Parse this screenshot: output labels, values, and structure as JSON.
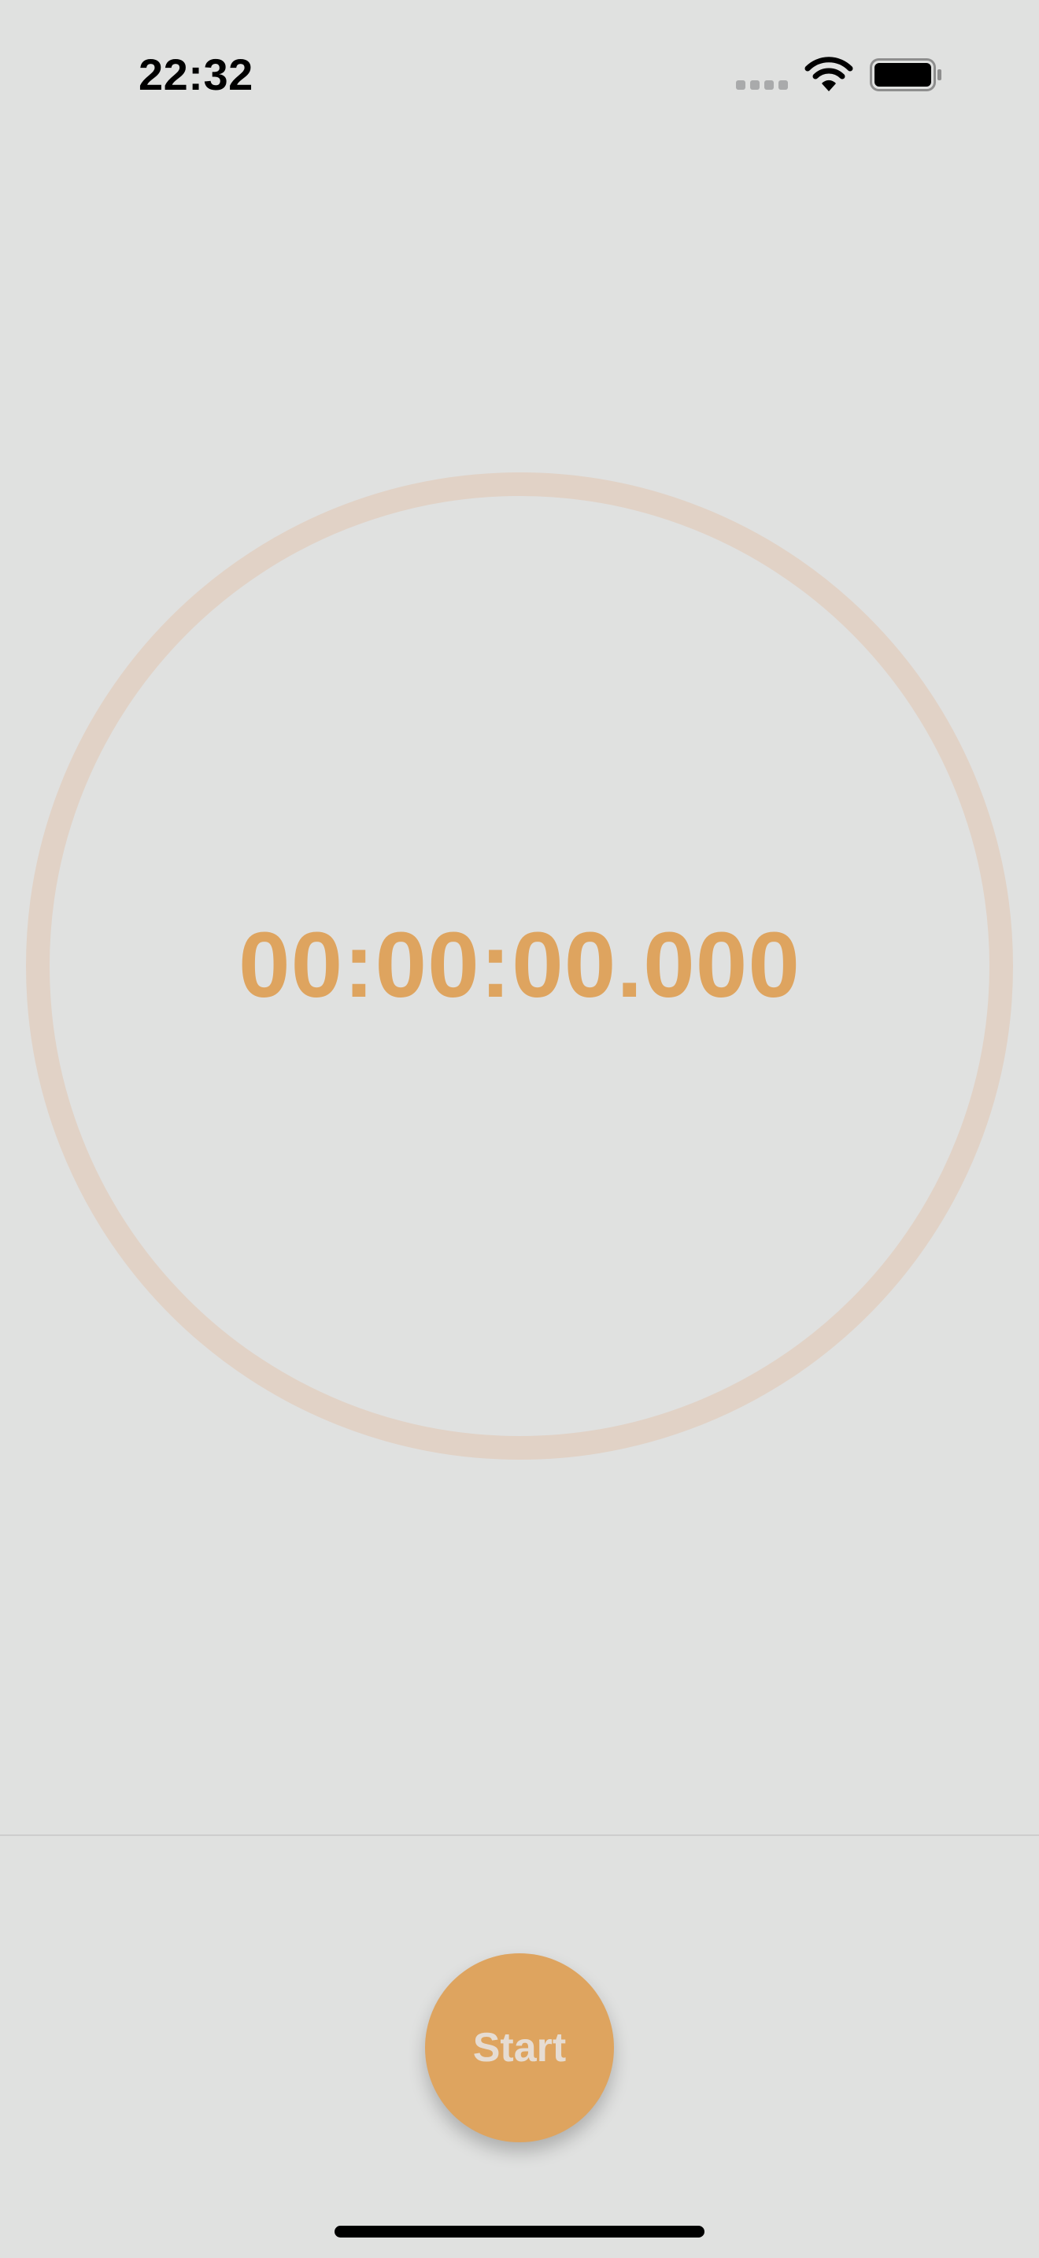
{
  "status_bar": {
    "time": "22:32",
    "icons": [
      "cellular-signal-icon",
      "wifi-icon",
      "battery-icon"
    ]
  },
  "timer": {
    "display": "00:00:00.000",
    "ring_progress": 0
  },
  "controls": {
    "start_label": "Start"
  },
  "colors": {
    "background": "#e0e1e0",
    "accent": "#dea45f",
    "ring": "#e1d2c6",
    "button_text": "#e6dcd2"
  }
}
